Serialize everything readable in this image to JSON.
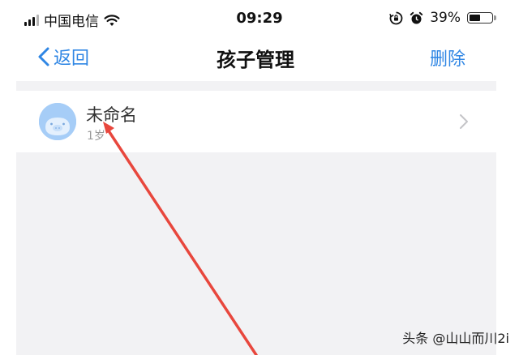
{
  "status_bar": {
    "carrier": "中国电信",
    "time": "09:29",
    "battery_percent": "39%",
    "battery_level": 0.39,
    "icons": [
      "signal-icon",
      "wifi-icon",
      "rotation-lock-icon",
      "alarm-icon",
      "battery-icon"
    ]
  },
  "nav": {
    "back_label": "返回",
    "title": "孩子管理",
    "action_label": "删除"
  },
  "children": [
    {
      "name": "未命名",
      "age": "1岁",
      "avatar_icon": "pig-avatar-icon"
    }
  ],
  "watermark": "头条 @山山而川2i",
  "colors": {
    "accent": "#2f86e4",
    "background": "#f2f2f4",
    "annotation_arrow": "#e8473d"
  }
}
